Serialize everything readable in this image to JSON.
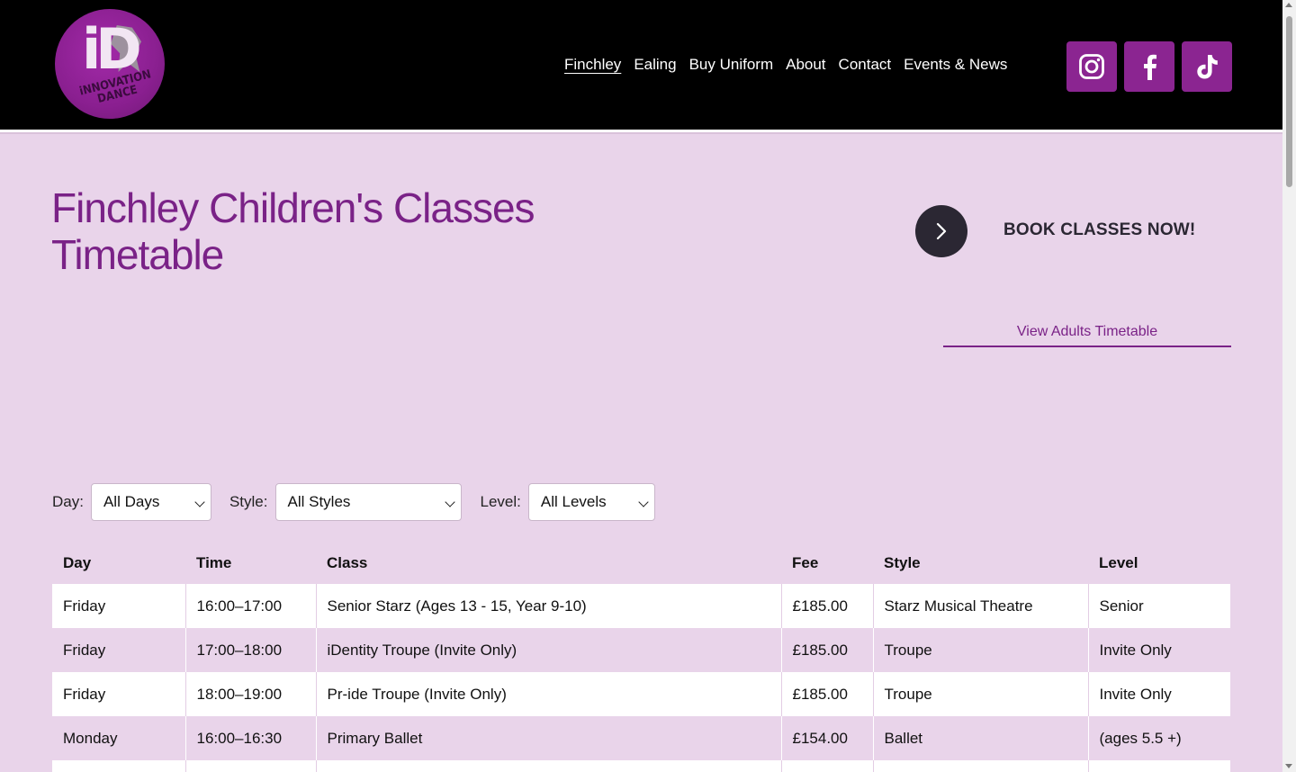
{
  "brand": {
    "logo_text": "iD",
    "logo_wordmark": "iNNOVATION DANCE"
  },
  "nav": [
    {
      "label": "Finchley",
      "active": true
    },
    {
      "label": "Ealing"
    },
    {
      "label": "Buy Uniform"
    },
    {
      "label": "About"
    },
    {
      "label": "Contact"
    },
    {
      "label": "Events & News"
    }
  ],
  "social": [
    {
      "icon": "instagram-icon"
    },
    {
      "icon": "facebook-icon"
    },
    {
      "icon": "tiktok-icon"
    }
  ],
  "page": {
    "title": "Finchley Children's Classes Timetable",
    "book_label": "BOOK CLASSES NOW!",
    "adults_link": "View Adults Timetable"
  },
  "filters": {
    "day_label": "Day:",
    "day_value": "All Days",
    "style_label": "Style:",
    "style_value": "All Styles",
    "level_label": "Level:",
    "level_value": "All Levels"
  },
  "table": {
    "headers": [
      "Day",
      "Time",
      "Class",
      "Fee",
      "Style",
      "Level"
    ],
    "rows": [
      [
        "Friday",
        "16:00–17:00",
        "Senior Starz (Ages 13 - 15, Year 9-10)",
        "£185.00",
        "Starz Musical Theatre",
        "Senior"
      ],
      [
        "Friday",
        "17:00–18:00",
        "iDentity Troupe (Invite Only)",
        "£185.00",
        "Troupe",
        "Invite Only"
      ],
      [
        "Friday",
        "18:00–19:00",
        "Pr-ide Troupe (Invite Only)",
        "£185.00",
        "Troupe",
        "Invite Only"
      ],
      [
        "Monday",
        "16:00–16:30",
        "Primary Ballet",
        "£154.00",
        "Ballet",
        "(ages 5.5 +)"
      ],
      [
        "",
        "",
        "",
        "",
        "",
        ""
      ]
    ]
  },
  "colors": {
    "accent": "#8b2591",
    "title": "#7a2287",
    "background": "#e9d4ea",
    "header": "#000000",
    "dark_button": "#2b2733"
  }
}
